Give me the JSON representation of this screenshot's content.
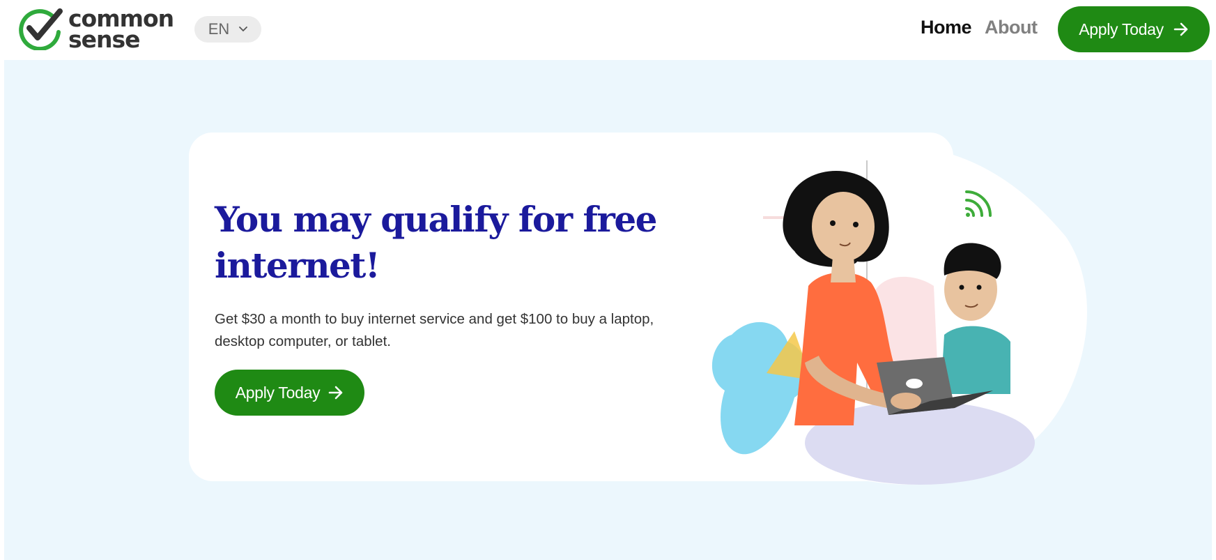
{
  "header": {
    "logo": {
      "line1": "common",
      "line2": "sense"
    },
    "language": {
      "selected": "EN"
    },
    "nav": {
      "home_label": "Home",
      "about_label": "About"
    },
    "cta_label": "Apply Today"
  },
  "hero": {
    "title": "You may qualify for free internet!",
    "description": "Get $30 a month to buy internet service and get $100 to buy a laptop, desktop computer, or tablet.",
    "cta_label": "Apply Today"
  },
  "colors": {
    "brand_green": "#1f8a14",
    "title_blue": "#1b1a9c",
    "hero_background": "#ecf7fd",
    "nav_active": "#111111",
    "nav_inactive": "#808080"
  },
  "icons": [
    "common-sense-check-logo",
    "chevron-down-icon",
    "arrow-right-icon",
    "wifi-icon"
  ]
}
